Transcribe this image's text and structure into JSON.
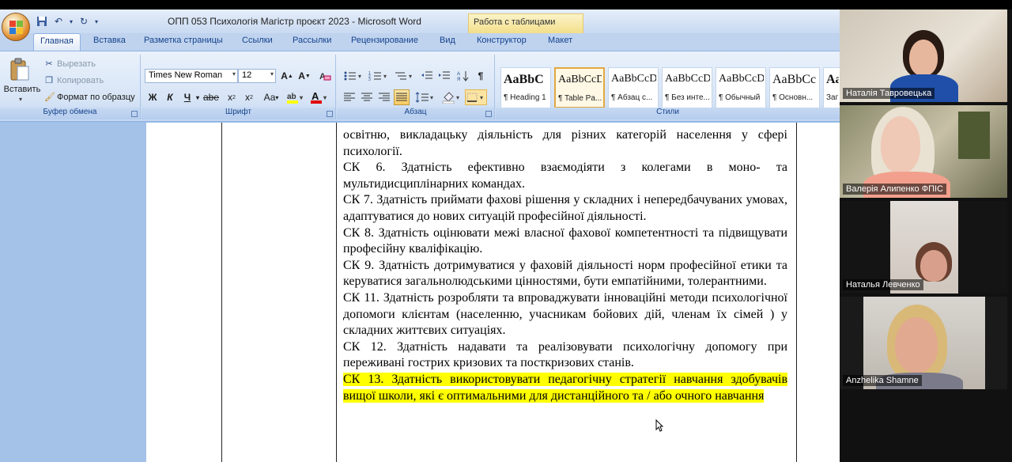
{
  "window": {
    "title": "ОПП 053 Психологія Магістр проєкт 2023 - Microsoft Word",
    "context_tab_title": "Работа с таблицами"
  },
  "tabs": [
    {
      "label": "Главная",
      "active": true
    },
    {
      "label": "Вставка"
    },
    {
      "label": "Разметка страницы"
    },
    {
      "label": "Ссылки"
    },
    {
      "label": "Рассылки"
    },
    {
      "label": "Рецензирование"
    },
    {
      "label": "Вид"
    },
    {
      "label": "Конструктор"
    },
    {
      "label": "Макет"
    }
  ],
  "clipboard": {
    "paste_label": "Вставить",
    "cut_label": "Вырезать",
    "copy_label": "Копировать",
    "format_painter_label": "Формат по образцу",
    "group_label": "Буфер обмена"
  },
  "font": {
    "font_name": "Times New Roman",
    "font_size": "12",
    "group_label": "Шрифт",
    "case_label": "Аа"
  },
  "paragraph": {
    "group_label": "Абзац"
  },
  "styles": {
    "group_label": "Стили",
    "items": [
      {
        "sample": "AaBbC",
        "name": "¶ Heading 1"
      },
      {
        "sample": "AaBbCcD",
        "name": "¶ Table Pa..."
      },
      {
        "sample": "AaBbCcD",
        "name": "¶ Абзац с..."
      },
      {
        "sample": "AaBbCcD",
        "name": "¶ Без инте..."
      },
      {
        "sample": "AaBbCcD",
        "name": "¶ Обычный"
      },
      {
        "sample": "AaBbCc",
        "name": "¶ Основн..."
      },
      {
        "sample": "AaB",
        "name": "Заг"
      }
    ]
  },
  "document": {
    "paragraphs": [
      {
        "text": "освітню, викладацьку діяльність для різних категорій населення у сфері психології."
      },
      {
        "text": "СК 6. Здатність ефективно взаємодіяти з колегами в моно- та мультидисциплінарних командах."
      },
      {
        "text": "СК 7. Здатність приймати фахові рішення у складних і непередбачуваних умовах, адаптуватися до нових ситуацій професійної діяльності."
      },
      {
        "text": "СК 8. Здатність оцінювати межі власної фахової компетентності та підвищувати професійну кваліфікацію."
      },
      {
        "text": "СК 9. Здатність дотримуватися у фаховій діяльності норм професійної етики та керуватися загальнолюдськими цінностями, бути емпатійними, толерантними."
      },
      {
        "text": "СК 11. Здатність розробляти та впроваджувати інноваційні методи психологічної допомоги клієнтам (населенню, учасникам бойових дій, членам їх сімей ) у складних життєвих ситуаціях."
      },
      {
        "text": "СК 12. Здатність надавати та реалізовувати психологічну допомогу при переживані гострих кризових та посткризових станів."
      },
      {
        "text": "СК 13. Здатність використовувати педагогічну стратегії навчання здобувачів вищої школи, які є оптимальними для дистанційного та / або очного навчання",
        "highlight": "#ffff00"
      }
    ]
  },
  "participants": [
    {
      "name": "Наталія Тавровецька"
    },
    {
      "name": "Валерія Алипенко ФПІС"
    },
    {
      "name": "Наталья Левченко"
    },
    {
      "name": "Anzhelika Shamne"
    }
  ]
}
